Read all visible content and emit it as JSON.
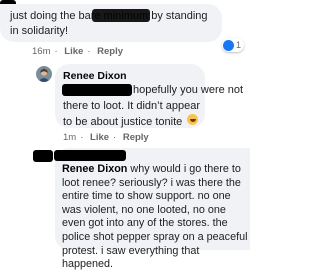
{
  "comments": [
    {
      "text": "just doing the bare minimum by standing in solidarity!",
      "time": "16m",
      "like_label": "Like",
      "reply_label": "Reply",
      "reaction_count": "1",
      "reaction": "like"
    },
    {
      "author": "Renee Dixon",
      "text_line1": "hopefully you were not",
      "text_rest": "there to loot. It didn’t appear to be about justice tonite",
      "reaction_emoji": "laugh",
      "time": "1m",
      "like_label": "Like",
      "reply_label": "Reply"
    },
    {
      "author": "Renee Dixon",
      "text": "why would i go there to loot renee? seriously? i was there the entire time to show support. no one was violent, no one looted, no one even got into any of the stores. the police shot pepper spray on a peaceful protest. i saw everything that happened."
    }
  ],
  "colors": {
    "bubble": "#f0f2f5",
    "meta": "#65676b",
    "redaction": "#000000",
    "like_blue": "#1877f2"
  }
}
